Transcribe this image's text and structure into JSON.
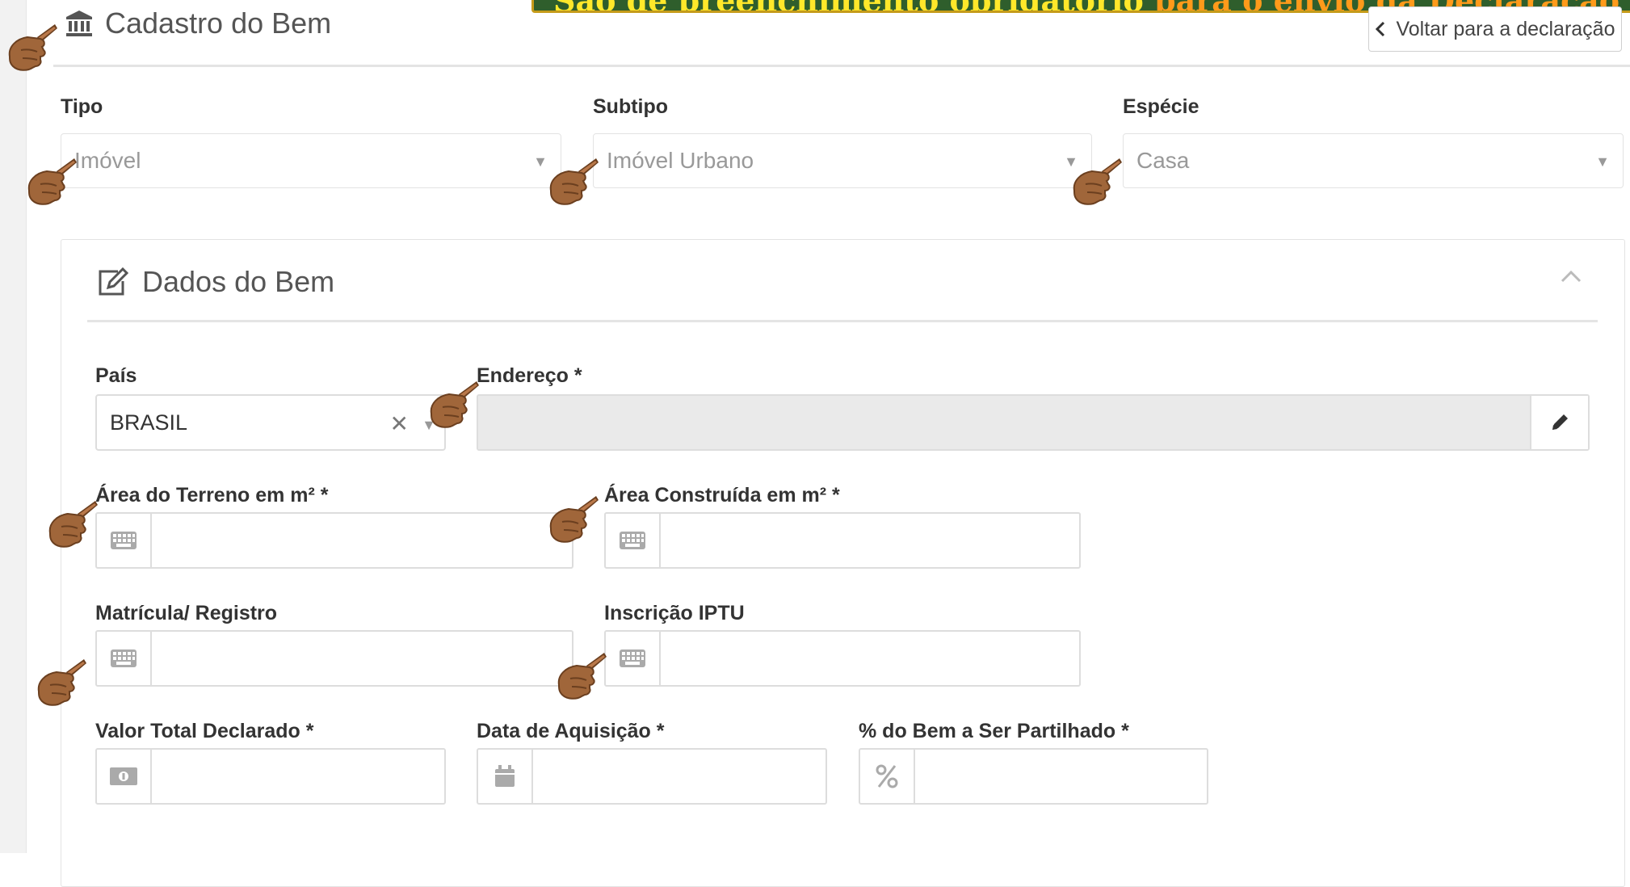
{
  "banner": {
    "part1": "São de preenchimento obrigatório",
    "part2": "para o envio da Declaração"
  },
  "header": {
    "title": "Cadastro do Bem",
    "back_label": "Voltar para a declaração"
  },
  "classification": {
    "tipo_label": "Tipo",
    "tipo_value": "Imóvel",
    "subtipo_label": "Subtipo",
    "subtipo_value": "Imóvel Urbano",
    "especie_label": "Espécie",
    "especie_value": "Casa"
  },
  "panel": {
    "title": "Dados do Bem"
  },
  "fields": {
    "pais_label": "País",
    "pais_value": "BRASIL",
    "endereco_label": "Endereço *",
    "area_terreno_label": "Área do Terreno em m² *",
    "area_construida_label": "Área Construída em m² *",
    "matricula_label": "Matrícula/ Registro",
    "iptu_label": "Inscrição IPTU",
    "valor_label": "Valor Total Declarado *",
    "data_label": "Data de Aquisição *",
    "percentual_label": "% do Bem a Ser Partilhado *"
  },
  "icons": {
    "header": "bank-icon",
    "back": "chevron-left-icon",
    "panel": "edit-icon",
    "collapse": "chevron-up-icon",
    "area": "keyboard-icon",
    "valor": "money-icon",
    "data": "calendar-icon",
    "percent": "percent-icon",
    "address_edit": "pencil-icon",
    "pointer": "pointing-hand-icon"
  },
  "colors": {
    "banner_bg": "#2f5e2c",
    "banner_yellow": "#ffe82a",
    "banner_orange": "#ff9a1a",
    "hand": "#a0663a"
  }
}
